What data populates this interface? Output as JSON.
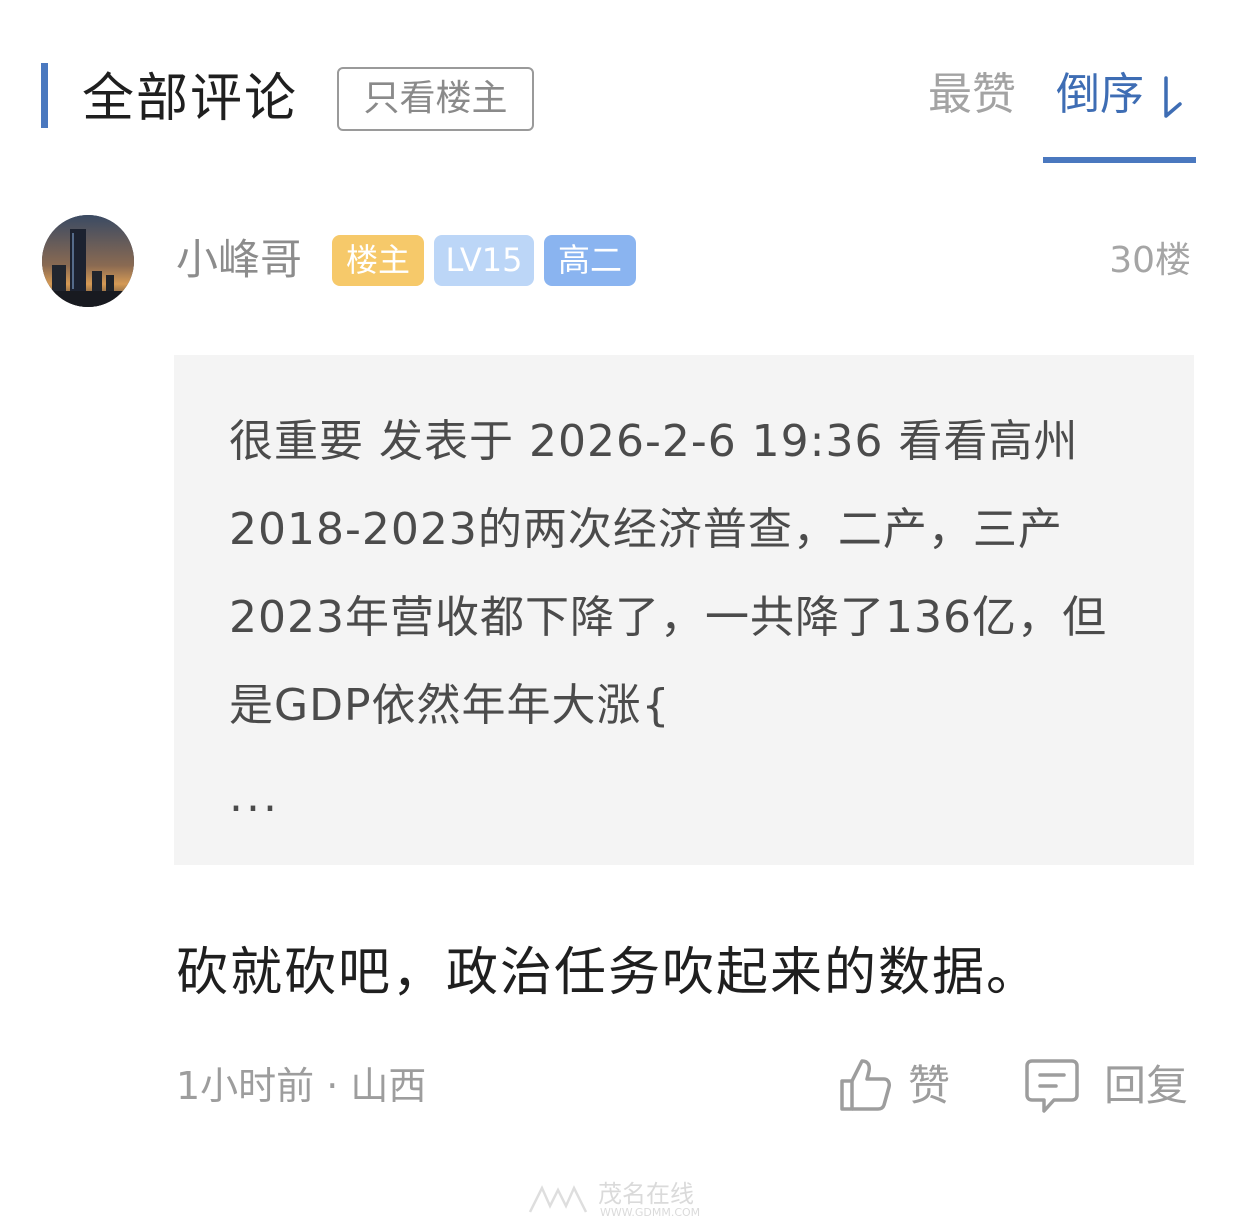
{
  "header": {
    "title": "全部评论",
    "only_op_label": "只看楼主",
    "sort_hot_label": "最赞",
    "sort_desc_label": "倒序",
    "accent_color": "#4a78bf"
  },
  "post": {
    "username": "小峰哥",
    "badges": {
      "op": "楼主",
      "level": "LV15",
      "grade": "高二"
    },
    "floor": "30楼",
    "quote": {
      "text": "很重要 发表于 2026-2-6 19:36 看看高州2018-2023的两次经济普查，二产，三产2023年营收都下降了，一共降了136亿，但是GDP依然年年大涨{",
      "ellipsis": "..."
    },
    "comment": "砍就砍吧，政治任务吹起来的数据。",
    "meta": "1小时前 · 山西",
    "actions": {
      "like_label": "赞",
      "reply_label": "回复"
    }
  },
  "watermark": {
    "name": "茂名在线",
    "url": "WWW.GDMM.COM"
  },
  "icons": {
    "sort": "arrow-down-icon",
    "like": "thumbs-up-icon",
    "reply": "comment-icon"
  }
}
